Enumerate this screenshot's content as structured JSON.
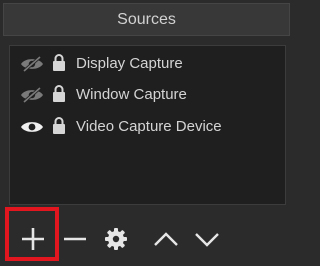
{
  "panel": {
    "title": "Sources"
  },
  "sources": [
    {
      "name": "Display Capture",
      "visible": false,
      "locked": true
    },
    {
      "name": "Window Capture",
      "visible": false,
      "locked": true
    },
    {
      "name": "Video Capture Device",
      "visible": true,
      "locked": true
    }
  ],
  "toolbar": {
    "buttons": [
      {
        "name": "add-source",
        "icon": "plus-icon",
        "highlighted": true
      },
      {
        "name": "remove-source",
        "icon": "minus-icon"
      },
      {
        "name": "source-properties",
        "icon": "gear-icon"
      },
      {
        "name": "move-source-up",
        "icon": "chevron-up-icon"
      },
      {
        "name": "move-source-down",
        "icon": "chevron-down-icon"
      }
    ]
  },
  "colors": {
    "background": "#2b2b2b",
    "list_background": "#1f1f1f",
    "text": "#d4d4d4",
    "icon": "#e6e6e6",
    "hidden_icon": "#7a7a7a",
    "highlight": "#e1161f"
  }
}
